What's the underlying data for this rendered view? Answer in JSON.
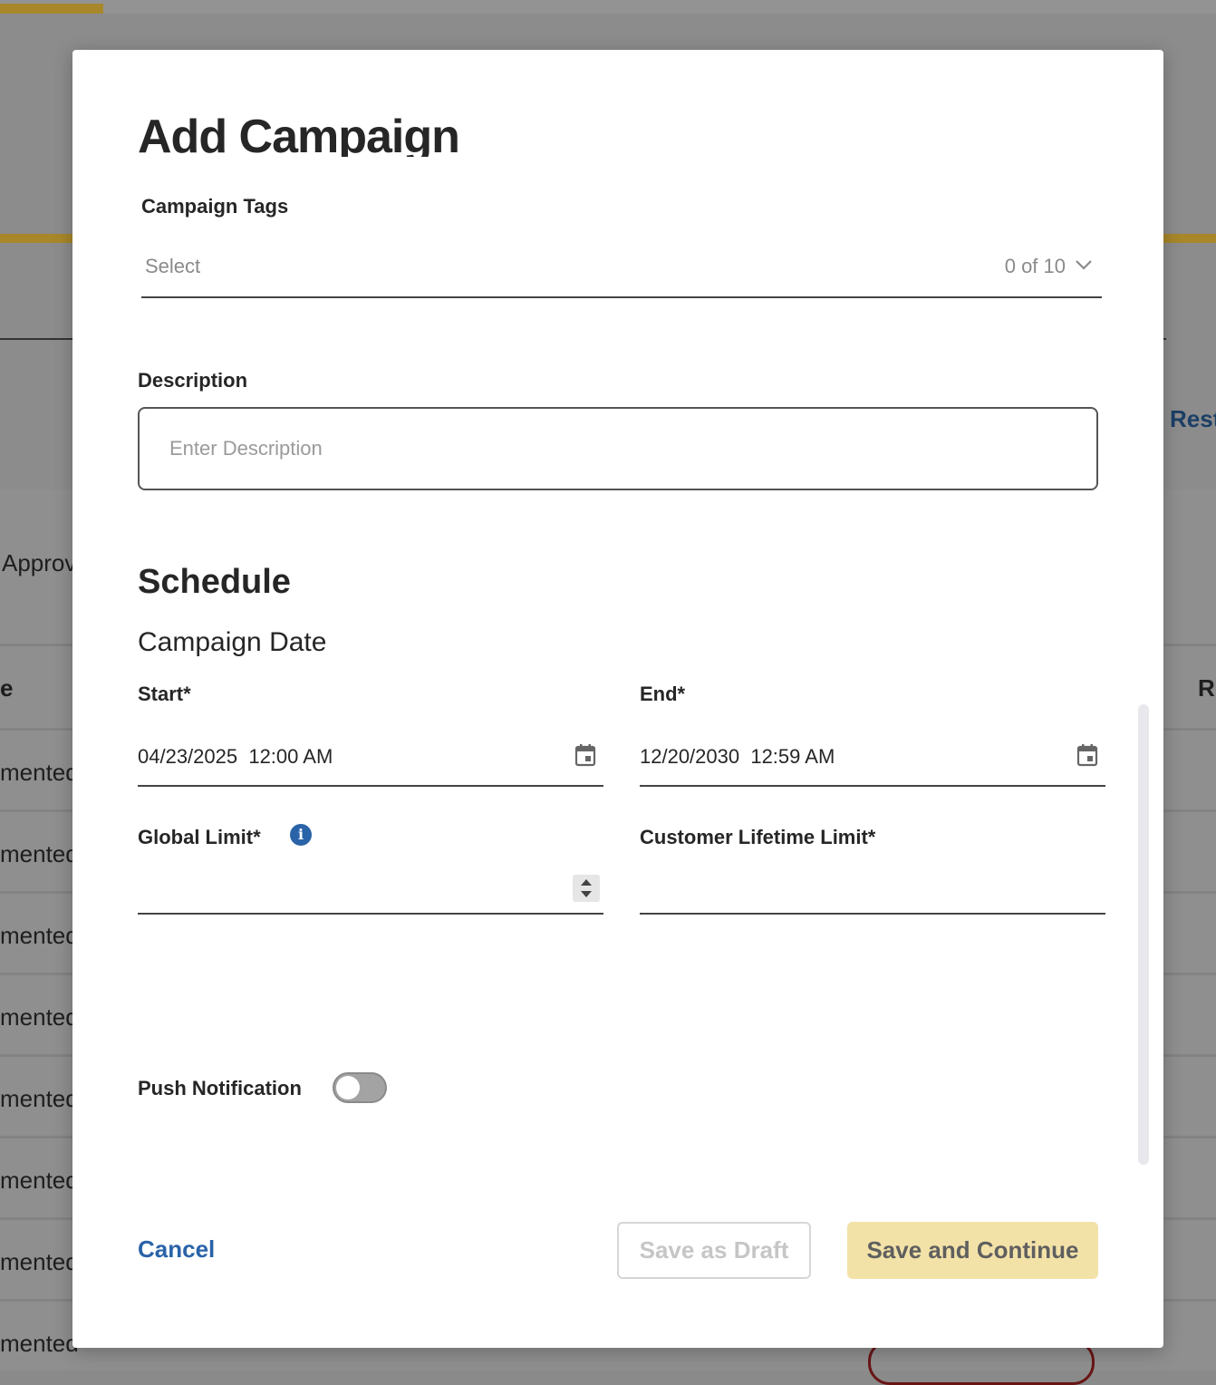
{
  "background": {
    "side_text": "Approv",
    "header_fragment_left": "e",
    "header_fragment_right": "R",
    "link_fragment": "Rest",
    "row_fragment": "mented"
  },
  "modal": {
    "title": "Add Campaign",
    "campaign_tags": {
      "label": "Campaign Tags",
      "placeholder": "Select",
      "count": "0 of 10"
    },
    "description": {
      "label": "Description",
      "placeholder": "Enter Description",
      "value": ""
    },
    "schedule": {
      "heading": "Schedule",
      "subheading": "Campaign Date",
      "start": {
        "label": "Start*",
        "value": "04/23/2025  12:00 AM"
      },
      "end": {
        "label": "End*",
        "value": "12/20/2030  12:59 AM"
      },
      "global_limit": {
        "label": "Global Limit*",
        "value": ""
      },
      "customer_lifetime_limit": {
        "label": "Customer Lifetime Limit*",
        "value": ""
      }
    },
    "push_notification": {
      "label": "Push Notification",
      "enabled": false
    },
    "actions": {
      "cancel": "Cancel",
      "save_draft": "Save as Draft",
      "save_continue": "Save and Continue"
    }
  },
  "colors": {
    "accent_gold": "#a8872a",
    "link_blue": "#2a63a8",
    "primary_button_disabled": "#f3e2a8"
  }
}
